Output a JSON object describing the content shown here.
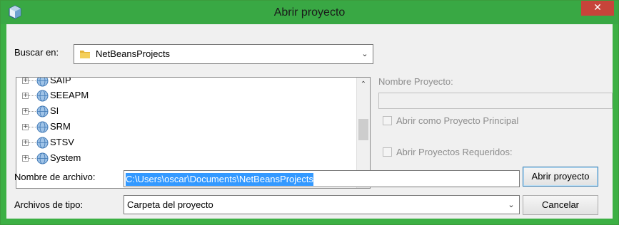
{
  "window": {
    "title": "Abrir proyecto",
    "close_label": "✕"
  },
  "colors": {
    "titlebar": "#39a844",
    "close": "#c7443a",
    "selection": "#3399ff"
  },
  "lookin": {
    "label": "Buscar en:",
    "value": "NetBeansProjects",
    "icon": "folder-icon"
  },
  "tree": {
    "items": [
      {
        "name": "SAIP",
        "icon": "globe-icon"
      },
      {
        "name": "SEEAPM",
        "icon": "globe-icon"
      },
      {
        "name": "SI",
        "icon": "globe-icon"
      },
      {
        "name": "SRM",
        "icon": "globe-icon"
      },
      {
        "name": "STSV",
        "icon": "globe-icon"
      },
      {
        "name": "System",
        "icon": "globe-icon"
      }
    ]
  },
  "project_panel": {
    "name_label": "Nombre Proyecto:",
    "name_value": "",
    "main_project_label": "Abrir como Proyecto Principal",
    "required_projects_label": "Abrir Proyectos Requeridos:"
  },
  "filename": {
    "label": "Nombre de archivo:",
    "value": "C:\\Users\\oscar\\Documents\\NetBeansProjects"
  },
  "filetype": {
    "label": "Archivos de tipo:",
    "value": "Carpeta del proyecto"
  },
  "buttons": {
    "open": "Abrir proyecto",
    "cancel": "Cancelar"
  }
}
